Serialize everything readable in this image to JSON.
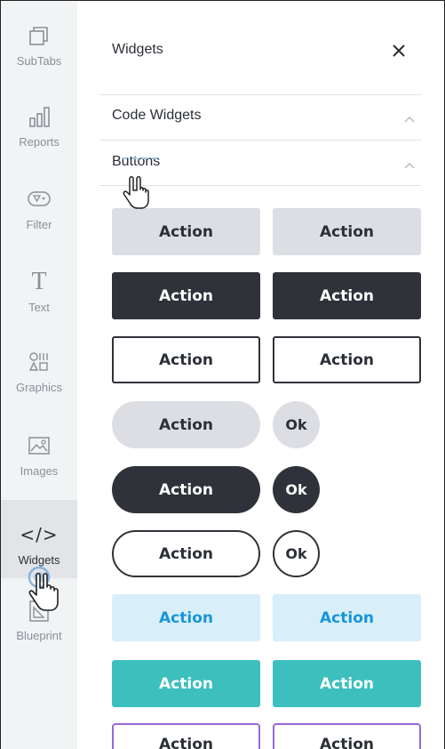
{
  "sidebar": {
    "items": [
      {
        "label": "SubTabs",
        "icon": "subtabs-icon"
      },
      {
        "label": "Reports",
        "icon": "reports-icon"
      },
      {
        "label": "Filter",
        "icon": "filter-icon"
      },
      {
        "label": "Text",
        "icon": "text-icon"
      },
      {
        "label": "Graphics",
        "icon": "graphics-icon"
      },
      {
        "label": "Images",
        "icon": "images-icon"
      },
      {
        "label": "Widgets",
        "icon": "widgets-icon",
        "active": true
      },
      {
        "label": "Blueprint",
        "icon": "blueprint-icon"
      }
    ],
    "text_glyph": "T",
    "widgets_glyph": "</>"
  },
  "panel": {
    "title": "Widgets",
    "close_glyph": "✕",
    "sections": [
      {
        "label": "Code Widgets"
      },
      {
        "label": "Buttons"
      }
    ]
  },
  "buttons": {
    "action": "Action",
    "ok": "Ok"
  },
  "colors": {
    "sidebar_bg": "#f2f3f5",
    "active_bg": "#e2e4e8",
    "dark": "#2f3238",
    "grey": "#dcdee4",
    "light_blue": "#d8eef9",
    "blue_text": "#1796d7",
    "teal": "#3dbfbe",
    "purple": "#9a68d8"
  }
}
